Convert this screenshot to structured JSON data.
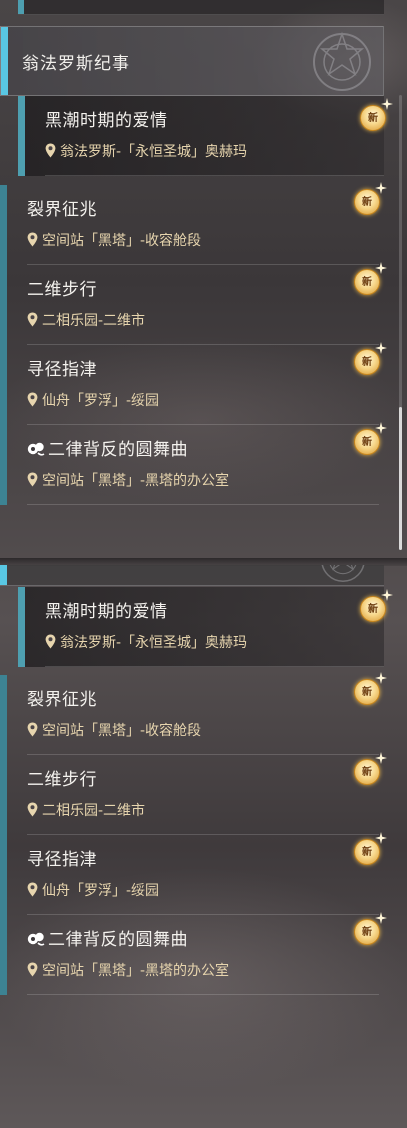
{
  "section": {
    "title": "翁法罗斯纪事"
  },
  "quests": [
    {
      "title": "黑潮时期的爱情",
      "location": "翁法罗斯-「永恒圣城」奥赫玛",
      "selected": true,
      "badge": "新"
    },
    {
      "title": "裂界征兆",
      "location": "空间站「黑塔」-收容舱段",
      "selected": false,
      "badge": "新"
    },
    {
      "title": "二维步行",
      "location": "二相乐园-二维市",
      "selected": false,
      "badge": "新"
    },
    {
      "title": "寻径指津",
      "location": "仙舟「罗浮」-绥园",
      "selected": false,
      "badge": "新"
    },
    {
      "title": "二律背反的圆舞曲",
      "location": "空间站「黑塔」-黑塔的办公室",
      "selected": false,
      "badge": "新",
      "title_icon": "companion-quest-icon"
    }
  ],
  "icons": {
    "location": "map-pin-icon",
    "new_badge": "new-badge-icon",
    "emblem": "emblem-icon"
  },
  "colors": {
    "accent": "#59c7e3",
    "quest_bar": "#3d8393",
    "location_text": "#e7d5ae",
    "badge": "#f7d88c"
  }
}
